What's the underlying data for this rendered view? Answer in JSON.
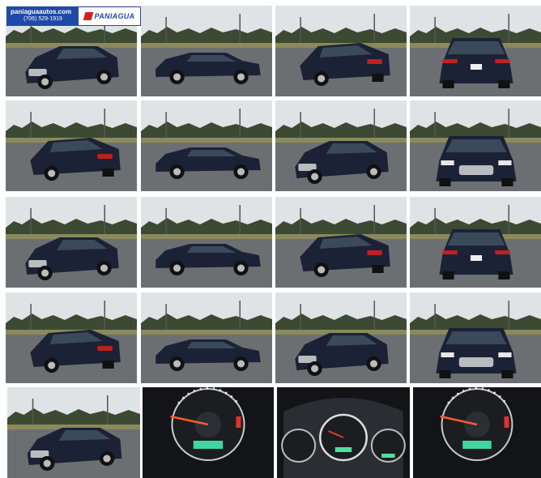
{
  "dealer": {
    "website": "paniaguaautos.com",
    "phone": "(706) 529-1919",
    "brand": "PANIAGUA"
  },
  "gallery": {
    "photos": [
      {
        "view": "front-left-quarter"
      },
      {
        "view": "left-side-profile"
      },
      {
        "view": "rear-left-quarter"
      },
      {
        "view": "rear"
      },
      {
        "view": "rear-left-quarter"
      },
      {
        "view": "left-side-profile"
      },
      {
        "view": "front-right-quarter"
      },
      {
        "view": "front"
      },
      {
        "view": "front-left-quarter"
      },
      {
        "view": "left-side-profile"
      },
      {
        "view": "rear-left-quarter"
      },
      {
        "view": "rear"
      },
      {
        "view": "rear-left-quarter"
      },
      {
        "view": "left-side-profile"
      },
      {
        "view": "front-right-quarter"
      },
      {
        "view": "front"
      },
      {
        "view": "front-left-quarter"
      },
      {
        "view": "speedometer"
      },
      {
        "view": "instrument-cluster"
      },
      {
        "view": "tachometer"
      }
    ]
  },
  "colors": {
    "car_body": "#1b2236",
    "sky": "#dfe3e6",
    "asphalt": "#6c6f72",
    "trees": "#3c4a34",
    "logo_blue": "#1f49a8",
    "logo_red": "#d42020"
  }
}
